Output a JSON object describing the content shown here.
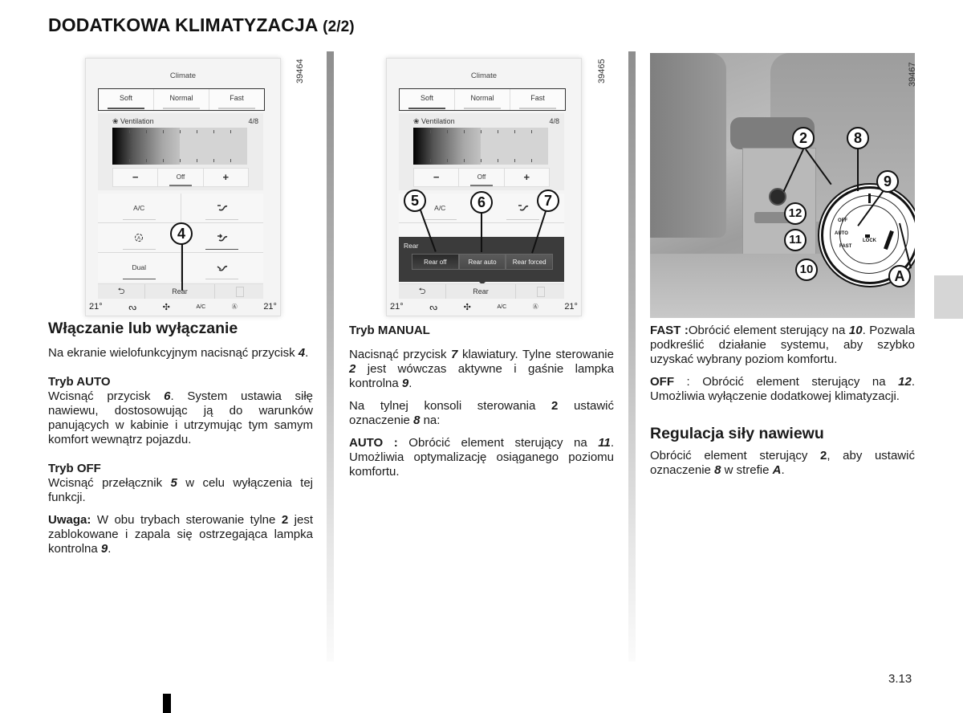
{
  "header": {
    "title": "DODATKOWA KLIMATYZACJA",
    "page_suffix": "(2/2)"
  },
  "figures": [
    {
      "code": "39464",
      "screen": {
        "title": "Climate",
        "tabs": [
          "Soft",
          "Normal",
          "Fast"
        ],
        "ventilation_label": "Ventilation",
        "ventilation_value": "4/8",
        "ventilation_fraction": 0.5,
        "minus": "−",
        "off": "Off",
        "plus": "+",
        "grid": [
          "A/C",
          "airflow-face-feet",
          "auto-recirculation",
          "airflow-feet",
          "Dual",
          "airflow-windscreen"
        ],
        "back": "⮌",
        "rear": "Rear",
        "status": {
          "temp_left": "21°",
          "temp_right": "21°",
          "ac": "A/C"
        }
      },
      "callouts": [
        "4"
      ]
    },
    {
      "code": "39465",
      "screen": {
        "title": "Climate",
        "tabs": [
          "Soft",
          "Normal",
          "Fast"
        ],
        "ventilation_label": "Ventilation",
        "ventilation_value": "4/8",
        "ventilation_fraction": 0.5,
        "minus": "−",
        "off": "Off",
        "plus": "+",
        "grid_top": [
          "A/C"
        ],
        "rear_popup": {
          "title": "Rear",
          "options": [
            "Rear off",
            "Rear auto",
            "Rear forced"
          ]
        },
        "back": "⮌",
        "rear": "Rear",
        "status": {
          "temp_left": "21°",
          "temp_right": "21°",
          "ac": "A/C"
        }
      },
      "callouts": [
        "5",
        "6",
        "7"
      ]
    },
    {
      "code": "39467",
      "dial_labels": {
        "off": "OFF",
        "auto": "AUTO",
        "fast": "FAST",
        "lock": "LOCK"
      },
      "callouts": [
        "2",
        "8",
        "9",
        "12",
        "11",
        "10",
        "A"
      ]
    }
  ],
  "col1": {
    "heading": "Włączanie lub wyłączanie",
    "p1_text": "Na ekranie wielofunkcyjnym nacisnąć przycisk ",
    "p1_num": "4",
    "auto_title": "Tryb AUTO",
    "auto_pre": "Wcisnąć przycisk ",
    "auto_num": "6",
    "auto_post": ". System ustawia siłę nawiewu, dostosowując ją do warunków panujących w kabinie i utrzymując tym samym komfort wewnątrz pojazdu.",
    "off_title": "Tryb OFF",
    "off_pre": "Wcisnąć przełącznik ",
    "off_num": "5",
    "off_post": " w celu wyłączenia tej funkcji.",
    "note_label": "Uwaga:",
    "note_pre": " W obu trybach sterowanie tylne ",
    "note_num1": "2",
    "note_mid": " jest zablokowane i zapala się ostrzegająca lampka kontrolna ",
    "note_num2": "9"
  },
  "col2": {
    "manual_title": "Tryb MANUAL",
    "p1_pre": "Nacisnąć przycisk ",
    "p1_num1": "7",
    "p1_mid": " klawiatury. Tylne sterowanie ",
    "p1_num2": "2",
    "p1_mid2": " jest wówczas aktywne i gaśnie lampka kontrolna ",
    "p1_num3": "9",
    "p2_pre": "Na tylnej konsoli sterowania ",
    "p2_num1": "2",
    "p2_mid": " ustawić oznaczenie ",
    "p2_num2": "8",
    "p2_post": " na:",
    "auto_label": "AUTO :",
    "auto_pre": " Obrócić element sterujący na ",
    "auto_num": "11",
    "auto_post": ". Umożliwia optymalizację osiąganego poziomu komfortu."
  },
  "col3": {
    "fast_label": "FAST :",
    "fast_pre": "Obrócić element sterujący na ",
    "fast_num": "10",
    "fast_post": ". Pozwala podkreślić działanie systemu, aby szybko uzyskać wybrany poziom komfortu.",
    "off_label": "OFF",
    "off_pre": " : Obrócić element sterujący na ",
    "off_num": "12",
    "off_post": ". Umożliwia wyłączenie dodatkowej klimatyzacji.",
    "heading": "Regulacja siły nawiewu",
    "p_pre": "Obrócić element sterujący ",
    "p_num1": "2",
    "p_mid": ", aby ustawić oznaczenie ",
    "p_num2": "8",
    "p_mid2": " w strefie ",
    "p_zone": "A"
  },
  "footer": {
    "page_number": "3.13"
  }
}
